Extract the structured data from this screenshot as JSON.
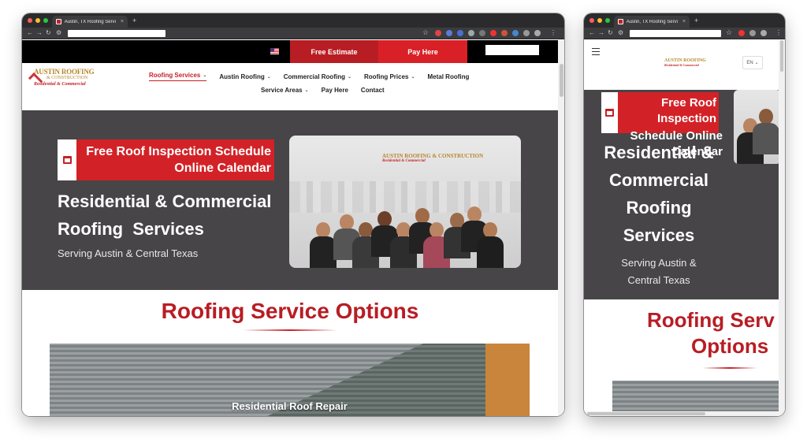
{
  "desktop": {
    "browser": {
      "tab_title": "Austin, TX Roofing Servic",
      "tab_close": "×",
      "new_tab": "+"
    },
    "topbar": {
      "free_estimate": "Free Estimate",
      "pay_here": "Pay Here"
    },
    "logo": {
      "line1": "AUSTIN ROOFING",
      "line2": "& CONSTRUCTION",
      "tagline": "Residential & Commercial"
    },
    "nav": {
      "row1": [
        {
          "label": "Roofing Services",
          "has_dropdown": true,
          "active": true
        },
        {
          "label": "Austin Roofing",
          "has_dropdown": true
        },
        {
          "label": "Commercial Roofing",
          "has_dropdown": true
        },
        {
          "label": "Roofing Prices",
          "has_dropdown": true
        },
        {
          "label": "Metal Roofing",
          "has_dropdown": false
        }
      ],
      "row2": [
        {
          "label": "Service Areas",
          "has_dropdown": true
        },
        {
          "label": "Pay Here",
          "has_dropdown": false
        },
        {
          "label": "Contact",
          "has_dropdown": false
        }
      ]
    },
    "hero": {
      "badge_line1": "Free Roof Inspection Schedule",
      "badge_line2": "Online Calendar",
      "heading_line1": "Residential & Commercial",
      "heading_line2": "Roofing  Services",
      "subheading": "Serving Austin & Central Texas",
      "photo_logo": "AUSTIN ROOFING & CONSTRUCTION",
      "photo_tagline": "Residential & Commercial"
    },
    "section": {
      "title": "Roofing Service Options",
      "card_caption": "Residential Roof Repair"
    }
  },
  "mobile": {
    "browser": {
      "tab_title": "Austin, TX Roofing Servic",
      "tab_close": "×",
      "new_tab": "+"
    },
    "header": {
      "logo": "AUSTIN ROOFING",
      "logo_sub": "Residential & Commercial",
      "lang": "EN"
    },
    "hero": {
      "badge_line1": "Free Roof",
      "badge_line2": "Inspection",
      "badge_tail1": "Schedule Online",
      "badge_tail2": "Calendar",
      "heading_lines": [
        "Residential &",
        "Commercial",
        "Roofing",
        "Services"
      ],
      "sub_line1": "Serving Austin &",
      "sub_line2": "Central Texas"
    },
    "section": {
      "title_line1": "Roofing Serv",
      "title_line2": "Options"
    }
  },
  "colors": {
    "brand_red": "#c62026",
    "pay_red": "#d92027",
    "hero_bg": "#474547",
    "logo_gold": "#b8862b"
  },
  "icons": [
    "calendar-icon",
    "us-flag-icon",
    "hamburger-menu-icon",
    "chevron-down-icon",
    "back-arrow-icon",
    "forward-arrow-icon",
    "reload-icon",
    "bookmark-star-icon"
  ]
}
